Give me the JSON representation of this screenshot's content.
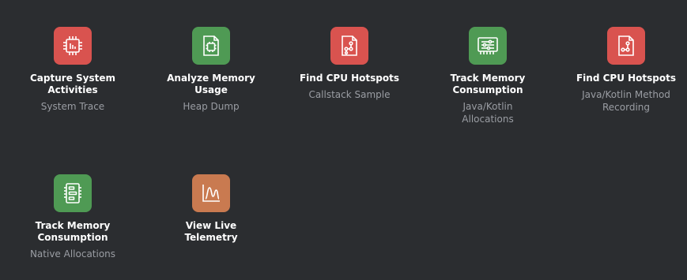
{
  "colors": {
    "background": "#2b2d30",
    "red": "#d9534f",
    "green": "#4f9a54",
    "orange": "#c97a50",
    "title": "#ffffff",
    "subtitle": "#9a9da3"
  },
  "tasks": [
    {
      "title": "Capture System Activities",
      "subtitle": "System Trace",
      "icon": "cpu-chip-icon",
      "color": "red"
    },
    {
      "title": "Analyze Memory Usage",
      "subtitle": "Heap Dump",
      "icon": "memory-chip-document-icon",
      "color": "green"
    },
    {
      "title": "Find CPU Hotspots",
      "subtitle": "Callstack Sample",
      "icon": "callstack-document-icon",
      "color": "red"
    },
    {
      "title": "Track Memory Consumption",
      "subtitle": "Java/Kotlin Allocations",
      "icon": "memory-allocation-icon",
      "color": "green"
    },
    {
      "title": "Find CPU Hotspots",
      "subtitle": "Java/Kotlin Method Recording",
      "icon": "method-trace-document-icon",
      "color": "red"
    },
    {
      "title": "Track Memory Consumption",
      "subtitle": "Native Allocations",
      "icon": "native-memory-icon",
      "color": "green"
    },
    {
      "title": "View Live Telemetry",
      "subtitle": "",
      "icon": "telemetry-wave-icon",
      "color": "orange"
    }
  ]
}
